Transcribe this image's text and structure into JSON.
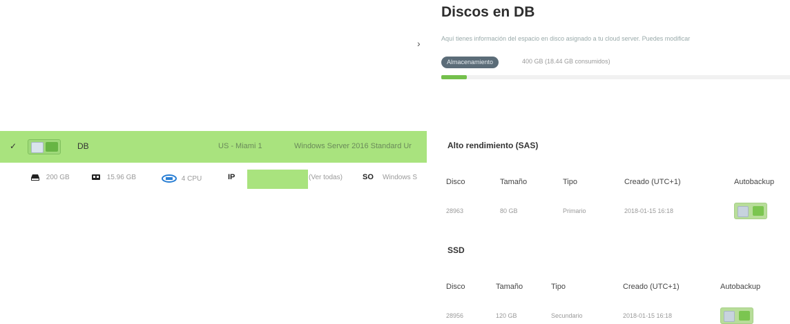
{
  "server": {
    "name": "DB",
    "location": "US - Miami 1",
    "os_full": "Windows Server 2016 Standard Ur",
    "disk": "200 GB",
    "ram": "15.96 GB",
    "cpu": "4 CPU",
    "ip_label": "IP",
    "view_all": "(Ver todas)",
    "so_label": "SO",
    "so_value": "Windows S"
  },
  "panel": {
    "title": "Discos en DB",
    "description": "Aquí tienes información del espacio en disco asignado a tu cloud server. Puedes modificar",
    "storage_badge": "Almacenamiento",
    "storage_info": "400 GB (18.44 GB consumidos)",
    "storage_used_fraction": 0.046
  },
  "sections": [
    {
      "title": "Alto rendimiento (SAS)",
      "headers": [
        "Disco",
        "Tamaño",
        "Tipo",
        "Creado (UTC+1)",
        "Autobackup"
      ],
      "rows": [
        {
          "disco": "28963",
          "tamano": "80 GB",
          "tipo": "Primario",
          "creado": "2018-01-15 16:18"
        }
      ]
    },
    {
      "title": "SSD",
      "headers": [
        "Disco",
        "Tamaño",
        "Tipo",
        "Creado (UTC+1)",
        "Autobackup"
      ],
      "rows": [
        {
          "disco": "28956",
          "tamano": "120 GB",
          "tipo": "Secundario",
          "creado": "2018-01-15 16:18"
        }
      ]
    }
  ],
  "colors": {
    "accent_green": "#a9e37e",
    "toggle_on": "#67b544",
    "badge_bg": "#5b6c78"
  }
}
